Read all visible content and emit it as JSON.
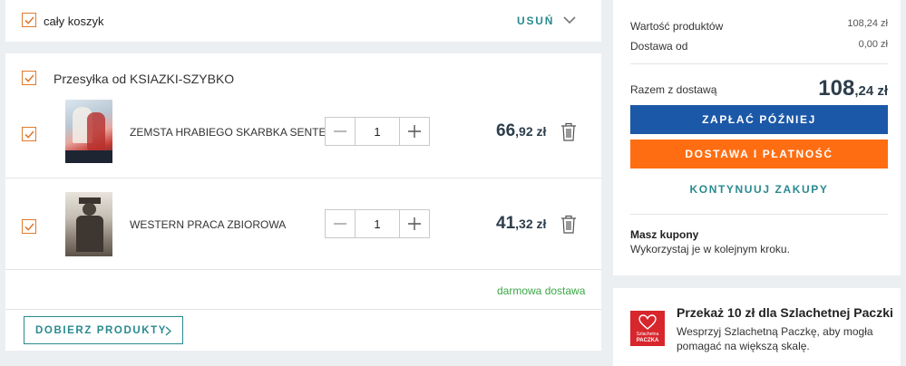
{
  "cart_header": {
    "select_all_label": "cały koszyk",
    "remove_label": "USUŃ"
  },
  "shipment": {
    "title": "Przesyłka od KSIAZKI-SZYBKO",
    "items": [
      {
        "name": "ZEMSTA HRABIEGO SKARBKA SENTE",
        "quantity": "1",
        "price_int": "66",
        "price_dec": ",92 zł"
      },
      {
        "name": "WESTERN PRACA ZBIOROWA",
        "quantity": "1",
        "price_int": "41",
        "price_dec": ",32 zł"
      }
    ],
    "delivery_note": "darmowa dostawa",
    "pick_products_label": "DOBIERZ PRODUKTY"
  },
  "summary": {
    "products_value_label": "Wartość produktów",
    "products_value": "108,24 zł",
    "delivery_label": "Dostawa od",
    "delivery_value": "0,00 zł",
    "total_label": "Razem z dostawą",
    "total_int": "108",
    "total_dec": ",24 zł",
    "pay_later_label": "ZAPŁAĆ PÓŹNIEJ",
    "checkout_label": "DOSTAWA I PŁATNOŚĆ",
    "continue_label": "KONTYNUUJ ZAKUPY",
    "coupons_title": "Masz kupony",
    "coupons_text": "Wykorzystaj je w kolejnym kroku."
  },
  "charity": {
    "title": "Przekaż 10 zł dla Szlachetnej Paczki",
    "line1": "Wesprzyj Szlachetną Paczkę, aby mogła",
    "line2": "pomagać na większą skalę.",
    "logo_text_1": "Szlachetna",
    "logo_text_2": "PACZKA"
  },
  "colors": {
    "checkbox": "#e07a2e",
    "teal_link": "#2a8a8f",
    "pay_later_bg": "#1c58a8",
    "checkout_bg": "#ff6d12",
    "free_delivery": "#3aa845",
    "price": "#2d3e4c",
    "charity_red": "#d7262c"
  },
  "icons": [
    "check-icon",
    "chevron-down-icon",
    "minus-icon",
    "plus-icon",
    "trash-icon",
    "chevron-right-icon",
    "heart-logo-icon"
  ]
}
